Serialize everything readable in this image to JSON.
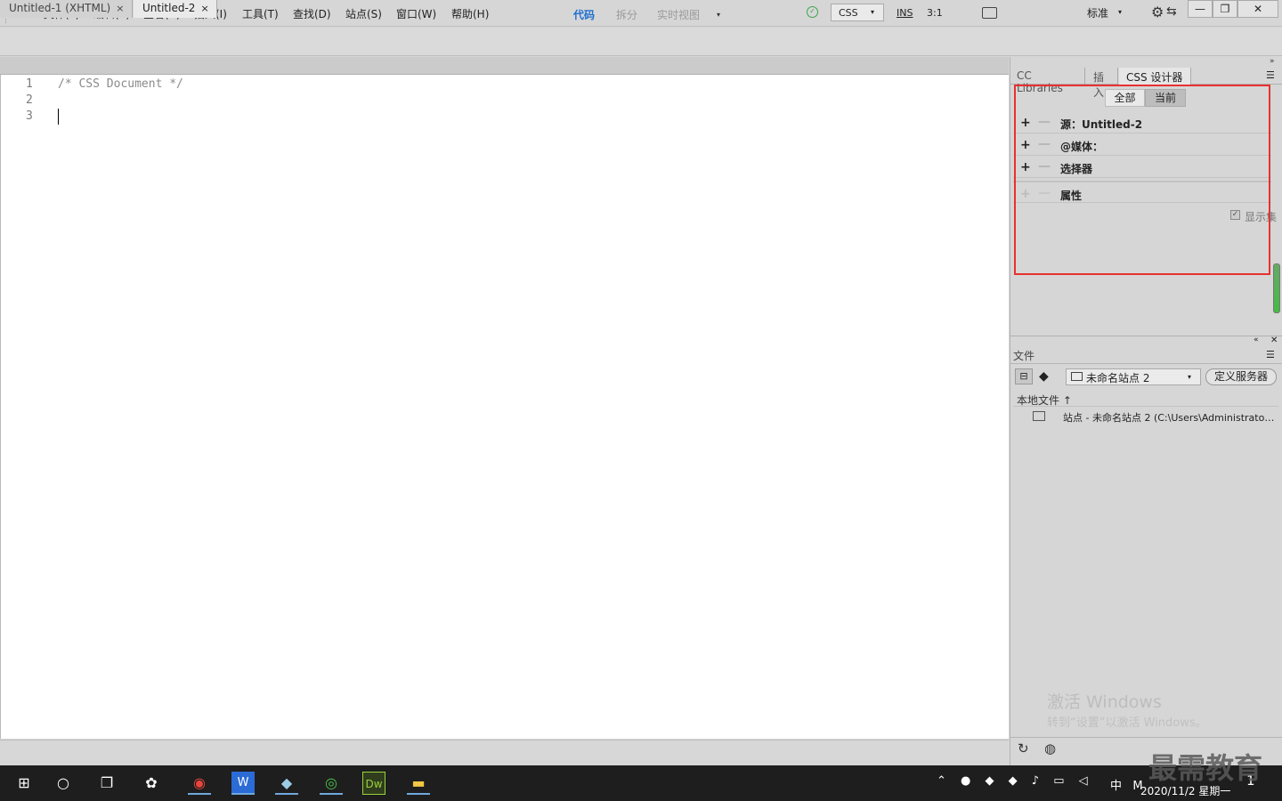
{
  "app": {
    "logo": "Dw"
  },
  "menu": [
    "文件(F)",
    "编辑(E)",
    "查看(V)",
    "插入(I)",
    "工具(T)",
    "查找(D)",
    "站点(S)",
    "窗口(W)",
    "帮助(H)"
  ],
  "workspace": {
    "label": "标准",
    "caret": "▾"
  },
  "window_controls": {
    "minimize": "—",
    "restore": "❐",
    "close": "✕"
  },
  "view_switch": {
    "code": "代码",
    "split": "拆分",
    "live": "实时视图",
    "caret": "▾"
  },
  "doc_tabs": [
    {
      "label": "Untitled-1 (XHTML)",
      "close": "×"
    },
    {
      "label": "Untitled-2",
      "close": "×"
    }
  ],
  "editor": {
    "line_numbers": [
      "1",
      "2",
      "3"
    ],
    "lines": [
      "/* CSS Document */",
      "",
      ""
    ]
  },
  "statusbar": {
    "language": "CSS",
    "ins": "INS",
    "cursor": "3:1"
  },
  "panel_tabs": [
    "CC Libraries",
    "插入",
    "CSS 设计器"
  ],
  "css_designer": {
    "seg_all": "全部",
    "seg_current": "当前",
    "rows": [
      {
        "label": "源：Untitled-2"
      },
      {
        "label": "@媒体："
      },
      {
        "label": "选择器"
      },
      {
        "label": "属性"
      }
    ],
    "show_set_label": "显示集",
    "plus": "+",
    "minus": "—"
  },
  "files_panel": {
    "tab": "文件",
    "site_select": "未命名站点 2",
    "define_server": "定义服务器",
    "local_files": "本地文件 ↑",
    "site_row": "站点 - 未命名站点 2 (C:\\Users\\Administrator\\..."
  },
  "activation": {
    "line1": "激活 Windows",
    "line2": "转到“设置”以激活 Windows。"
  },
  "taskbar": {
    "tray_ime": "中",
    "tray_m": "M",
    "date": "2020/11/2 星期一",
    "notify": "1"
  },
  "watermark": "最需教育",
  "colors": {
    "accent": "#1f6fd1",
    "highlight": "#e8312f",
    "dw_green": "#7bb031"
  }
}
